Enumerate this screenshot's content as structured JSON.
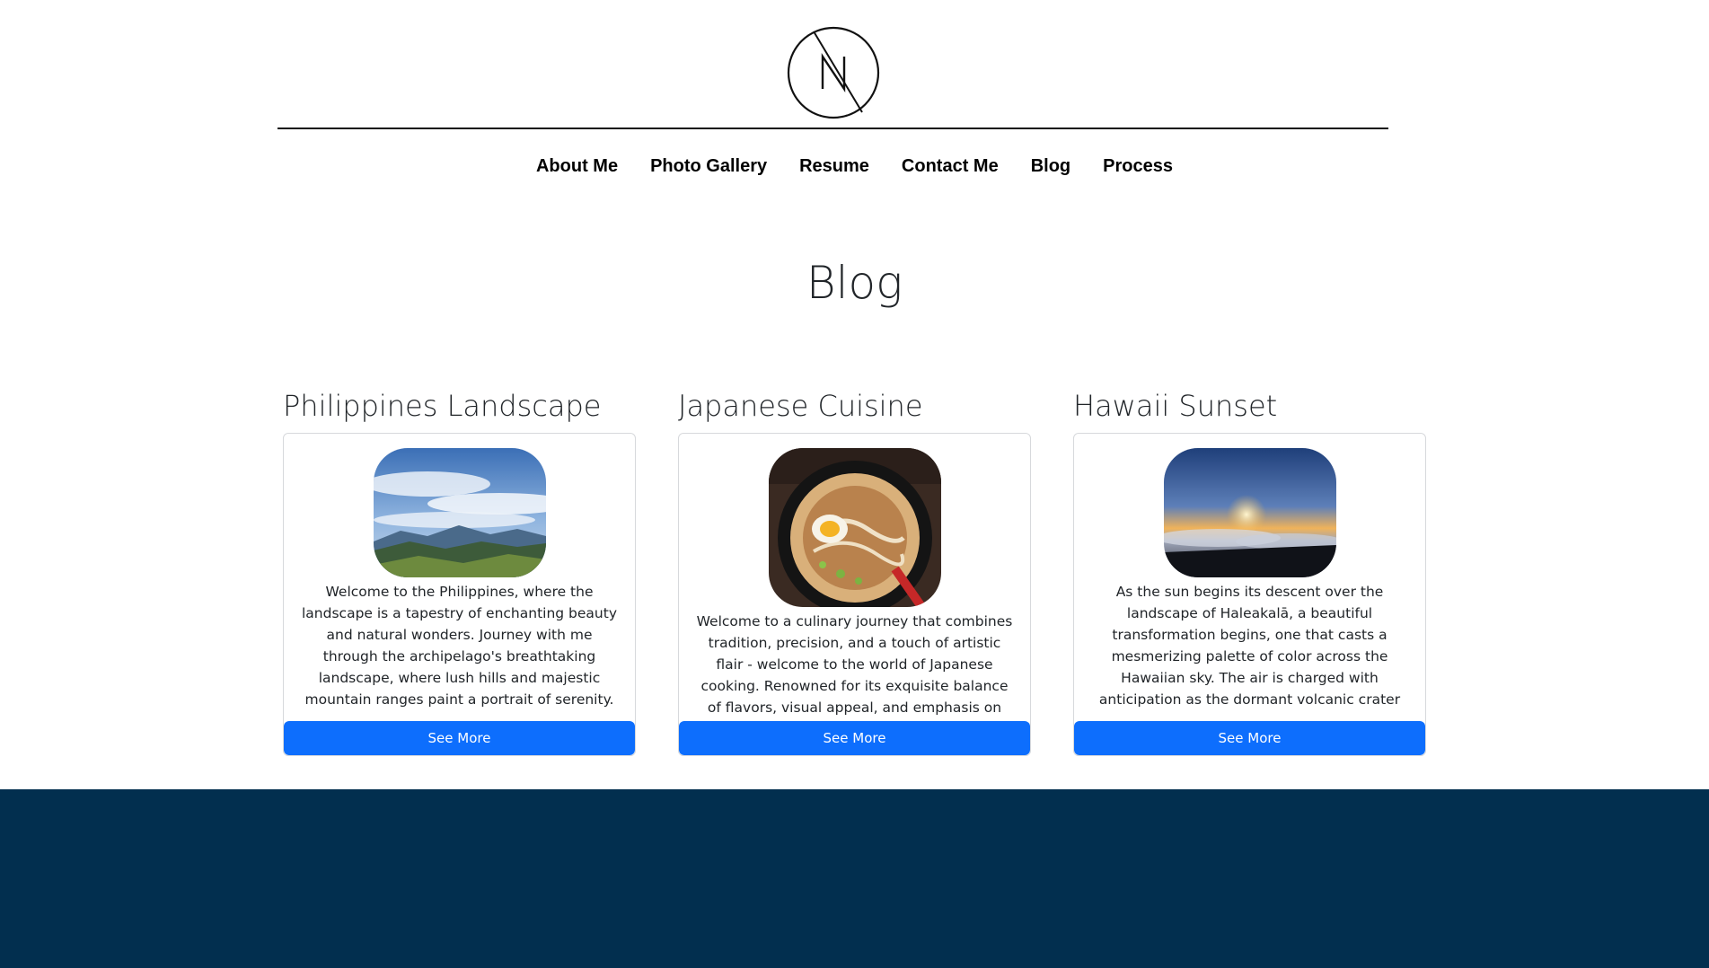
{
  "nav": {
    "items": [
      {
        "label": "About Me"
      },
      {
        "label": "Photo Gallery"
      },
      {
        "label": "Resume"
      },
      {
        "label": "Contact Me"
      },
      {
        "label": "Blog"
      },
      {
        "label": "Process"
      }
    ]
  },
  "page": {
    "title": "Blog"
  },
  "posts": [
    {
      "title": "Philippines Landscape",
      "text": "Welcome to the Philippines, where the landscape is a tapestry of enchanting beauty and natural wonders. Journey with me through the archipelago's breathtaking landscape, where lush hills and majestic mountain ranges paint a portrait of serenity. As you traverse the Philippine islands, you'll be captivated by the rolling hills draped in a",
      "button": "See More"
    },
    {
      "title": "Japanese Cuisine",
      "text": "Welcome to a culinary journey that combines tradition, precision, and a touch of artistic flair - welcome to the world of Japanese cooking. Renowned for its exquisite balance of flavors, visual appeal, and emphasis on fresh, high-quality",
      "button": "See More"
    },
    {
      "title": "Hawaii Sunset",
      "text": "As the sun begins its descent over the landscape of Haleakalā, a beautiful transformation begins, one that casts a mesmerizing palette of color across the Hawaiian sky. The air is charged with anticipation as the dormant volcanic crater comes alive in a breathtaking display of colors. Picture a canvas of warm oranges, vibrant pinks, and serene",
      "button": "See More"
    }
  ],
  "colors": {
    "button": "#0d6efd",
    "footer": "#022f4f"
  }
}
